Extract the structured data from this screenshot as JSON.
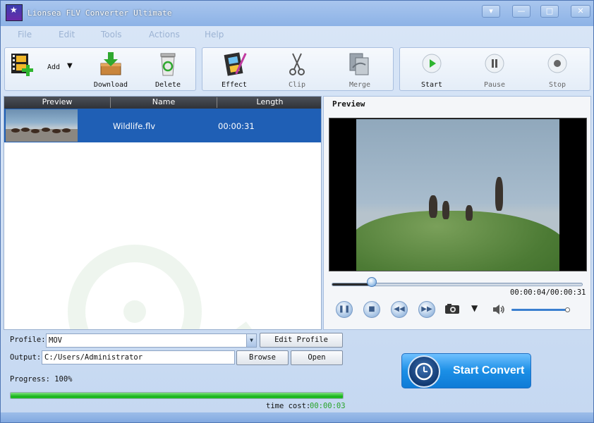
{
  "window": {
    "title": "Lionsea FLV Converter Ultimate",
    "controls": [
      "▾",
      "—",
      "□",
      "✕"
    ]
  },
  "menu": [
    "File",
    "Edit",
    "Tools",
    "Actions",
    "Help"
  ],
  "toolbar": {
    "add_label": "Add",
    "download_label": "Download",
    "delete_label": "Delete",
    "effect_label": "Effect",
    "clip_label": "Clip",
    "merge_label": "Merge",
    "start_label": "Start",
    "pause_label": "Pause",
    "stop_label": "Stop"
  },
  "file_list": {
    "columns": [
      "Preview",
      "Name",
      "Length"
    ],
    "rows": [
      {
        "name": "Wildlife.flv",
        "length": "00:00:31"
      }
    ]
  },
  "preview": {
    "title": "Preview",
    "time": "00:00:04/00:00:31",
    "seek_fraction": 0.16,
    "volume_fraction": 0.98
  },
  "profile": {
    "label": "Profile:",
    "value": "MOV",
    "edit_button": "Edit Profile"
  },
  "output": {
    "label": "Output:",
    "value": "C:/Users/Administrator",
    "browse_button": "Browse",
    "open_button": "Open"
  },
  "progress": {
    "label": "Progress: 100%",
    "fraction": 1.0,
    "time_cost_label": "time cost:",
    "time_cost_value": "00:00:03"
  },
  "convert": {
    "label": "Start Convert"
  },
  "colors": {
    "accent": "#1f5fb5",
    "progress": "#17b31b",
    "convert": "#1b8fe6"
  }
}
